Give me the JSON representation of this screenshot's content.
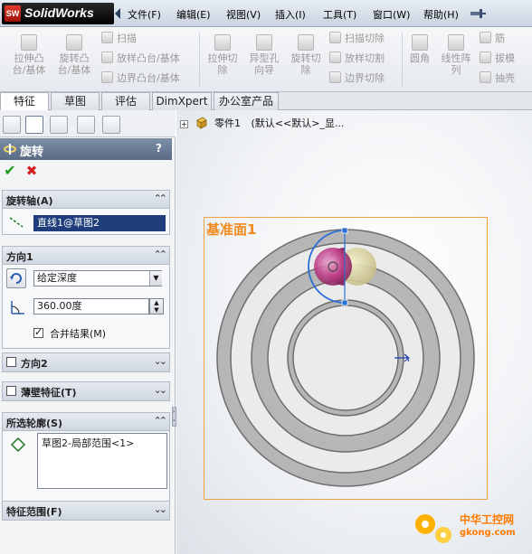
{
  "app": {
    "ds_mark": "SW",
    "brand": "SolidWorks"
  },
  "menu": [
    "文件(F)",
    "编辑(E)",
    "视图(V)",
    "插入(I)",
    "工具(T)",
    "窗口(W)",
    "帮助(H)"
  ],
  "ribbon": {
    "extrude_boss": [
      "拉伸凸",
      "台/基体"
    ],
    "revolve_boss": [
      "旋转凸",
      "台/基体"
    ],
    "sweep": "扫描",
    "loft_boss": "放样凸台/基体",
    "boundary_boss": "边界凸台/基体",
    "extrude_cut": [
      "拉伸切",
      "除"
    ],
    "hole_wizard": [
      "异型孔",
      "向导"
    ],
    "revolve_cut": [
      "旋转切",
      "除"
    ],
    "sweep_cut": "扫描切除",
    "loft_cut": "放样切割",
    "boundary_cut": "边界切除",
    "fillet": "圆角",
    "linear_pattern": [
      "线性阵",
      "列"
    ],
    "rib": "筋",
    "draft": "拔模",
    "shell": "抽壳"
  },
  "tabs": [
    "特征",
    "草图",
    "评估",
    "DimXpert",
    "办公室产品"
  ],
  "property_manager": {
    "title": "旋转",
    "help": "?",
    "axis": {
      "title": "旋转轴(A)",
      "value": "直线1@草图2"
    },
    "direction1": {
      "title": "方向1",
      "type": "给定深度",
      "angle": "360.00度",
      "merge_label": "合并结果(M)",
      "merge_checked": true
    },
    "direction2": {
      "title": "方向2",
      "checked": false
    },
    "thin": {
      "title": "薄壁特征(T)",
      "checked": false
    },
    "contours": {
      "title": "所选轮廓(S)",
      "items": [
        "草图2-局部范围<1>"
      ]
    },
    "scope": {
      "title": "特征范围(F)"
    }
  },
  "tree": {
    "part": "零件1",
    "config": "(默认<<默认>_显..."
  },
  "graphics": {
    "plane_label": "基准面1"
  },
  "watermark": {
    "line1": "中华工控网",
    "line2": "gkong.com"
  },
  "colors": {
    "plane": "#f0a040",
    "plane_label": "#f08a1c",
    "preview": "#c0408a",
    "axis_blue": "#2a6fd6",
    "accent_header": "#6a7c96"
  }
}
